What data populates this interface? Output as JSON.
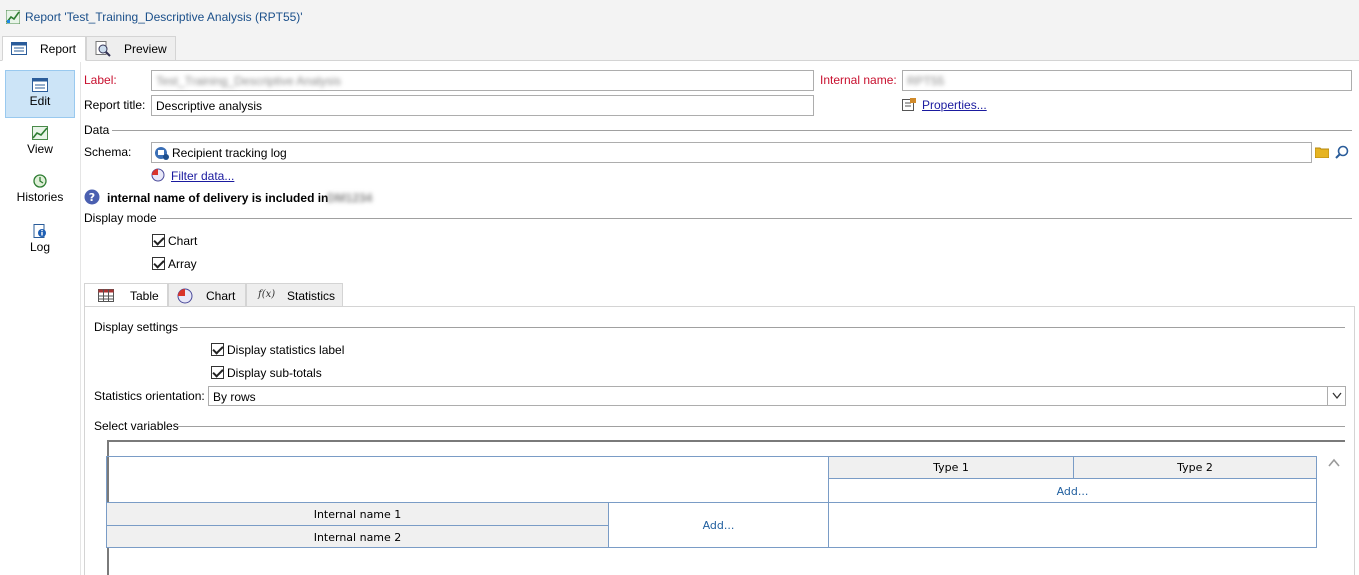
{
  "window": {
    "title": "Report 'Test_Training_Descriptive Analysis (RPT55)'"
  },
  "top_tabs": [
    {
      "label": "Report",
      "icon": "report-icon"
    },
    {
      "label": "Preview",
      "icon": "magnifier-icon"
    }
  ],
  "nav": [
    {
      "label": "Edit",
      "icon": "edit-form-icon"
    },
    {
      "label": "View",
      "icon": "chart-view-icon"
    },
    {
      "label": "Histories",
      "icon": "history-icon"
    },
    {
      "label": "Log",
      "icon": "log-info-icon"
    }
  ],
  "form": {
    "label_caption": "Label:",
    "label_value": "Test_Training_Descriptive Analysis",
    "internal_name_caption": "Internal name:",
    "internal_name_value": "RPT55",
    "report_title_caption": "Report title:",
    "report_title_value": "Descriptive analysis",
    "properties_link": "Properties...",
    "data_section": "Data",
    "schema_caption": "Schema:",
    "schema_value": "Recipient tracking log",
    "filter_link": "Filter data...",
    "filter_info_text": "internal name of delivery is included in",
    "filter_info_value": "DM1234",
    "display_mode_section": "Display mode",
    "display_chart": "Chart",
    "display_array": "Array"
  },
  "inner_tabs": [
    {
      "label": "Table",
      "icon": "table-grid-icon"
    },
    {
      "label": "Chart",
      "icon": "pie-chart-icon"
    },
    {
      "label": "Statistics",
      "icon": "function-icon",
      "icon_text": "f(x)"
    }
  ],
  "table_tab": {
    "display_settings_section": "Display settings",
    "display_statistics_label": "Display statistics label",
    "display_sub_totals": "Display sub-totals",
    "orientation_caption": "Statistics orientation:",
    "orientation_value": "By rows",
    "select_variables_section": "Select variables",
    "col_headers": [
      "Type 1",
      "Type 2"
    ],
    "col_add": "Add...",
    "row_headers": [
      "Internal name 1",
      "Internal name 2"
    ],
    "row_add": "Add..."
  },
  "colors": {
    "accent_red": "#c8102e",
    "link_blue": "#1a1a9f",
    "nav_selected": "#cce4f7"
  }
}
